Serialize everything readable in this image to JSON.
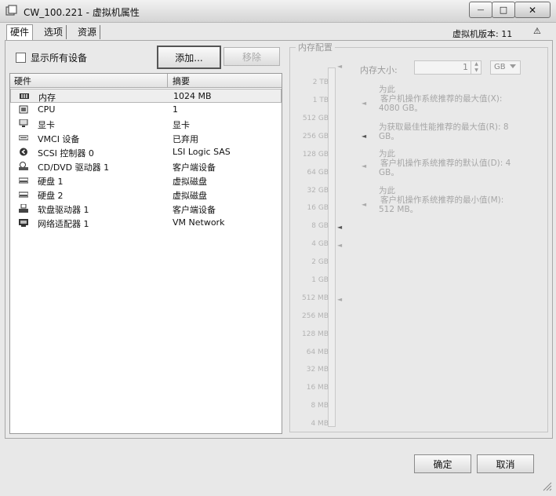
{
  "window": {
    "title": "CW_100.221 - 虚拟机属性",
    "minimize": "—",
    "maximize": "□",
    "close": "✕"
  },
  "tabs": [
    "硬件",
    "选项",
    "资源"
  ],
  "vm_version": "虚拟机版本: 11",
  "warning_icon": "⚠",
  "show_all_devices": "显示所有设备",
  "buttons": {
    "add": "添加...",
    "remove": "移除",
    "ok": "确定",
    "cancel": "取消"
  },
  "hardware_list": {
    "columns": [
      "硬件",
      "摘要"
    ],
    "rows": [
      {
        "icon": "memory-icon",
        "name": "内存",
        "summary": "1024 MB"
      },
      {
        "icon": "cpu-icon",
        "name": "CPU",
        "summary": "1"
      },
      {
        "icon": "display-icon",
        "name": "显卡",
        "summary": "显卡"
      },
      {
        "icon": "vmci-icon",
        "name": "VMCI 设备",
        "summary": "已弃用"
      },
      {
        "icon": "scsi-icon",
        "name": "SCSI 控制器 0",
        "summary": "LSI Logic SAS"
      },
      {
        "icon": "cd-dvd-icon",
        "name": "CD/DVD 驱动器 1",
        "summary": "客户端设备"
      },
      {
        "icon": "hard-disk-icon",
        "name": "硬盘 1",
        "summary": "虚拟磁盘"
      },
      {
        "icon": "hard-disk-icon",
        "name": "硬盘 2",
        "summary": "虚拟磁盘"
      },
      {
        "icon": "floppy-icon",
        "name": "软盘驱动器 1",
        "summary": "客户端设备"
      },
      {
        "icon": "network-icon",
        "name": "网络适配器 1",
        "summary": "VM Network"
      }
    ]
  },
  "memory_config": {
    "legend": "内存配置",
    "size_label": "内存大小:",
    "size_value": "1",
    "unit": "GB",
    "scale": [
      "2 TB",
      "1 TB",
      "512 GB",
      "256 GB",
      "128 GB",
      "64 GB",
      "32 GB",
      "16 GB",
      "8 GB",
      "4 GB",
      "2 GB",
      "1 GB",
      "512 MB",
      "256 MB",
      "128 MB",
      "64 MB",
      "32 MB",
      "16 MB",
      "8 MB",
      "4 MB"
    ],
    "recommendations": [
      {
        "line1": "为此",
        "line2": "客户机操作系统推荐的最大值(X):",
        "line3": "4080 GB。"
      },
      {
        "line1": "为获取最佳性能推荐的最大值(R): 8",
        "line2": "GB。",
        "line3": ""
      },
      {
        "line1": "为此",
        "line2": "客户机操作系统推荐的默认值(D): 4",
        "line3": "GB。"
      },
      {
        "line1": "为此",
        "line2": "客户机操作系统推荐的最小值(M):",
        "line3": "512 MB。"
      }
    ]
  }
}
